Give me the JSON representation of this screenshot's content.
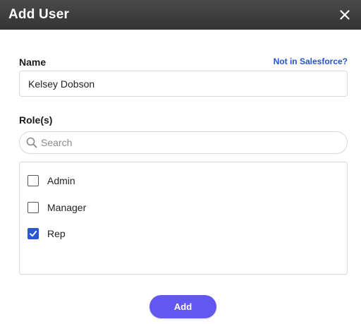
{
  "dialog": {
    "title": "Add User",
    "close_icon": "close-icon"
  },
  "name_section": {
    "label": "Name",
    "link_text": "Not in Salesforce?",
    "value": "Kelsey Dobson"
  },
  "roles_section": {
    "label": "Role(s)",
    "search_placeholder": "Search",
    "search_value": "",
    "items": [
      {
        "label": "Admin",
        "checked": false
      },
      {
        "label": "Manager",
        "checked": false
      },
      {
        "label": "Rep",
        "checked": true
      }
    ]
  },
  "footer": {
    "add_label": "Add"
  },
  "colors": {
    "titlebar": "#3c3c3c",
    "link": "#2353d6",
    "checkbox_checked": "#2856d6",
    "primary_button": "#6357f2"
  }
}
